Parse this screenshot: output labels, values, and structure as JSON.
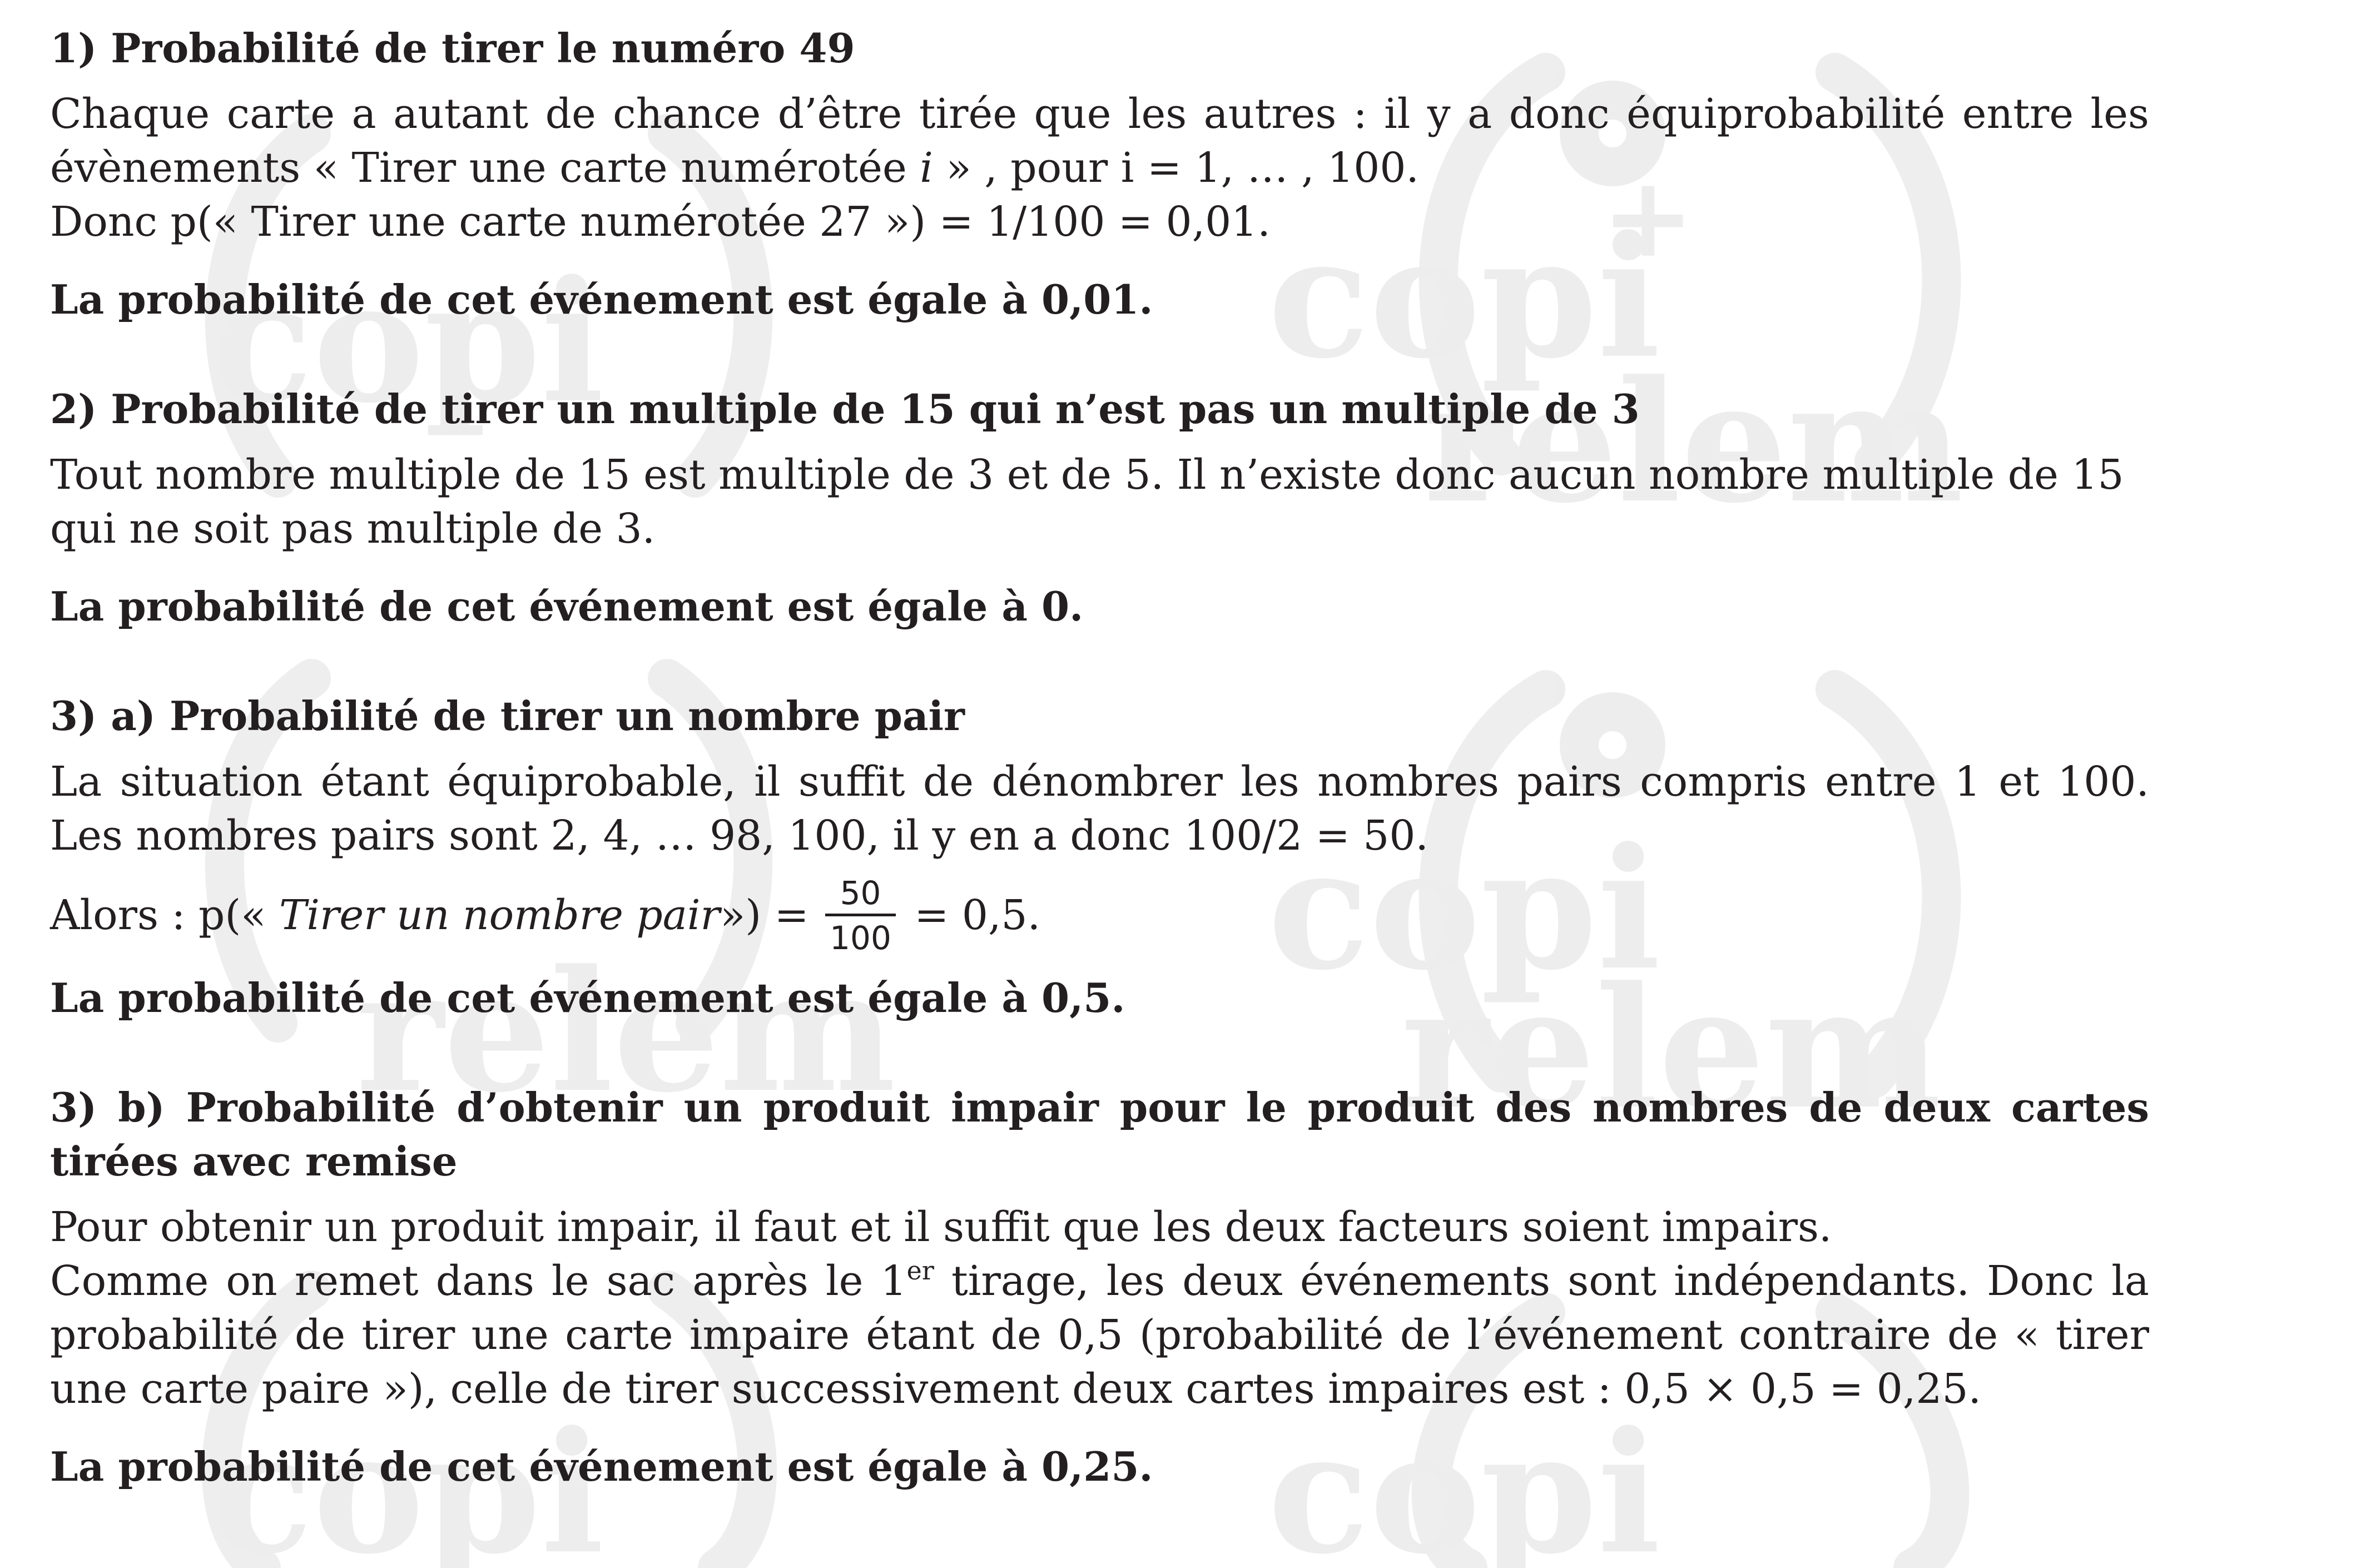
{
  "watermark": {
    "text_top": "copi",
    "text_bottom": "relem",
    "symbol": "+"
  },
  "section1": {
    "title": "1) Probabilité de tirer le numéro 49",
    "p1_a": "Chaque carte a autant de chance d’être tirée que les autres : il y a donc équiprobabilité entre les évènements « Tirer une carte numérotée ",
    "p1_var": "i",
    "p1_b": " » , pour i = 1, … , 100.",
    "p2": "Donc  p(« Tirer une carte numérotée 27 ») = 1/100 = 0,01.",
    "conclusion": "La probabilité de cet événement est égale à 0,01."
  },
  "section2": {
    "title": "2) Probabilité de tirer un multiple de 15 qui n’est pas un multiple de 3",
    "p1": "Tout nombre multiple de 15 est multiple de 3 et de 5. Il n’existe donc aucun nombre multiple de 15 qui ne soit pas multiple de 3.",
    "conclusion": "La probabilité de cet événement est égale à 0."
  },
  "section3a": {
    "title": "3)  a) Probabilité de tirer un nombre pair",
    "p1": "La situation étant équiprobable, il suffit de dénombrer les nombres pairs compris entre 1 et 100. Les nombres pairs sont 2, 4, … 98, 100, il y en a donc 100/2 = 50.",
    "formula_prefix": "Alors : p(« ",
    "formula_event": "Tirer un nombre pair",
    "formula_mid": "») = ",
    "frac_num": "50",
    "frac_den": "100",
    "formula_suffix": " = 0,5.",
    "conclusion": "La probabilité de cet événement est égale à 0,5."
  },
  "section3b": {
    "title": "3)  b) Probabilité d’obtenir un produit impair pour le produit des nombres de deux cartes tirées avec remise",
    "p1": "Pour obtenir un produit impair, il faut et il suffit que les deux facteurs soient impairs.",
    "p2_a": "Comme on remet dans le sac après le 1",
    "p2_sup": "er",
    "p2_b": " tirage, les deux événements sont indépendants. Donc la probabilité de tirer une carte impaire étant de 0,5 (probabilité de l’événement contraire de « tirer une carte paire »), celle de tirer successivement deux cartes impaires est :  0,5 × 0,5 = 0,25.",
    "conclusion": "La probabilité de cet événement est égale à 0,25."
  }
}
